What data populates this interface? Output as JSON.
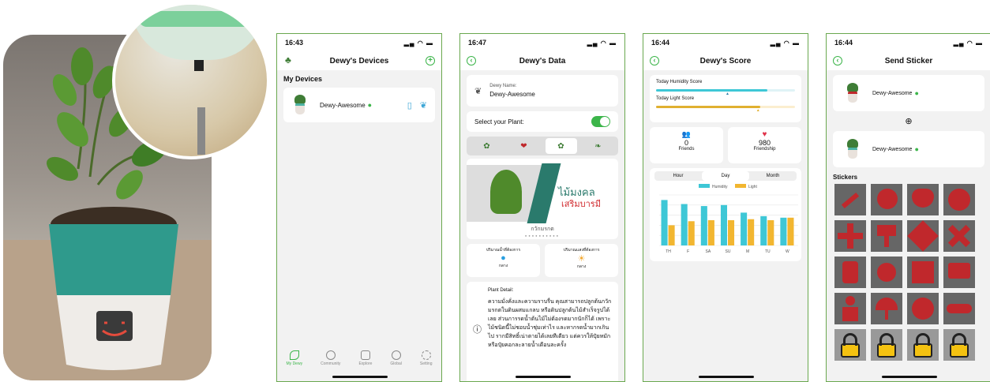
{
  "photo": {
    "alt": "Dewy plant pot photo"
  },
  "screen1": {
    "time": "16:43",
    "title": "Dewy's Devices",
    "section": "My Devices",
    "device_name": "Dewy-Awesome",
    "tabs": [
      {
        "label": "My Dewy"
      },
      {
        "label": "Community"
      },
      {
        "label": "Explore"
      },
      {
        "label": "Global"
      },
      {
        "label": "Setting"
      }
    ]
  },
  "screen2": {
    "time": "16:47",
    "title": "Dewy's Data",
    "name_label": "Dewy Name:",
    "name_value": "Dewy-Awesome",
    "select_label": "Select your Plant:",
    "banner_text1": "ไม้มงคล",
    "banner_text2": "เสริมบารมี",
    "plant_name": "กวักมรกต",
    "water_label": "ปริมาณน้ำที่ต้องการ",
    "water_value": "กลาง",
    "light_label": "ปริมาณแสงที่ต้องการ",
    "light_value": "กลาง",
    "detail_label": "Plant Detail:",
    "detail_text": "ความมั่งคั่งและความราบรื่น คุณสามารถปลูกต้นกวักมรกตในดินผสมแกลบ หรือดินปลูกต้นไม้สำเร็จรูปได้เลย ส่วนการรดน้ำต้นไม้ไม่ต้องรดมากนักก็ได้ เพราะไม้ชนิดนี้ไม่ชอบน้ำชุ่มเท่าไร และหากรดน้ำมากเกินไป รากมีสิทธิ์เน่าตายได้เลยทีเดียว แต่ควรให้ปุ๋ยหมัก หรือปุ๋ยคอกละลายน้ำเดือนละครั้ง"
  },
  "screen3": {
    "time": "16:44",
    "title": "Dewy's Score",
    "humidity_label": "Today Humidity Score",
    "light_label": "Today Light Score",
    "humidity_score": 0.8,
    "light_score": 0.75,
    "friends_value": "0",
    "friends_label": "Friends",
    "friendship_value": "980",
    "friendship_label": "Friendship",
    "segments": [
      "Hour",
      "Day",
      "Month"
    ],
    "legend_humidity": "Humidity",
    "legend_light": "Light",
    "humidity_color": "#3ec7d6",
    "light_color": "#f2b630"
  },
  "chart_data": {
    "type": "bar",
    "categories": [
      "TH",
      "F",
      "SA",
      "SU",
      "M",
      "TU",
      "W"
    ],
    "series": [
      {
        "name": "Humidity",
        "values": [
          90,
          82,
          78,
          80,
          65,
          58,
          55
        ]
      },
      {
        "name": "Light",
        "values": [
          40,
          48,
          50,
          50,
          52,
          50,
          55
        ]
      }
    ],
    "ylim": [
      0,
      100
    ],
    "grid": true,
    "legend": "top"
  },
  "screen4": {
    "time": "16:44",
    "title": "Send Sticker",
    "device1": "Dewy-Awesome",
    "device2": "Dewy-Awesome",
    "stickers_label": "Stickers"
  }
}
